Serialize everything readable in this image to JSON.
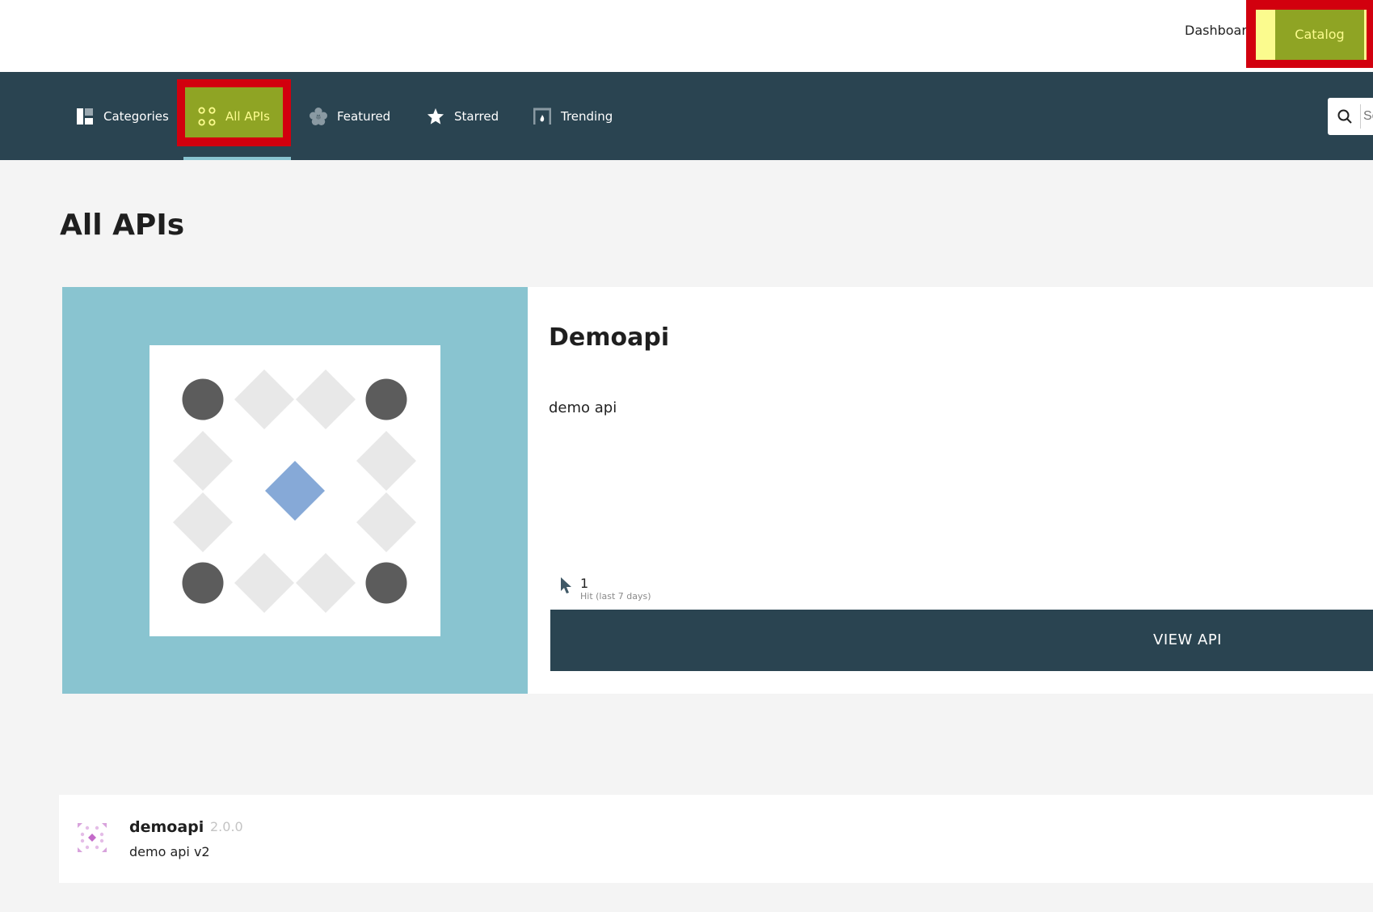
{
  "header": {
    "dashboard_label": "Dashboard",
    "catalog_label": "Catalog"
  },
  "nav": {
    "items": [
      {
        "label": "Categories",
        "icon": "categories-icon"
      },
      {
        "label": "All APIs",
        "icon": "all-apis-icon",
        "active": true
      },
      {
        "label": "Featured",
        "icon": "featured-icon"
      },
      {
        "label": "Starred",
        "icon": "star-icon"
      },
      {
        "label": "Trending",
        "icon": "trending-icon"
      }
    ],
    "search": {
      "placeholder": "Se",
      "icon": "search-icon"
    }
  },
  "page": {
    "title": "All APIs"
  },
  "featured": {
    "name": "Demoapi",
    "description": "demo api",
    "hits_count": "1",
    "hits_label": "Hit (last 7 days)",
    "button_label": "VIEW API"
  },
  "list": [
    {
      "name": "demoapi",
      "version": "2.0.0",
      "description": "demo api v2"
    }
  ],
  "colors": {
    "navbar": "#2a4451",
    "highlight_red": "#d2000e",
    "highlight_olive": "#8fa424",
    "highlight_yellow": "#fbfb8e",
    "art_background": "#89c4d0",
    "accent_diamond": "#86a9d7"
  }
}
